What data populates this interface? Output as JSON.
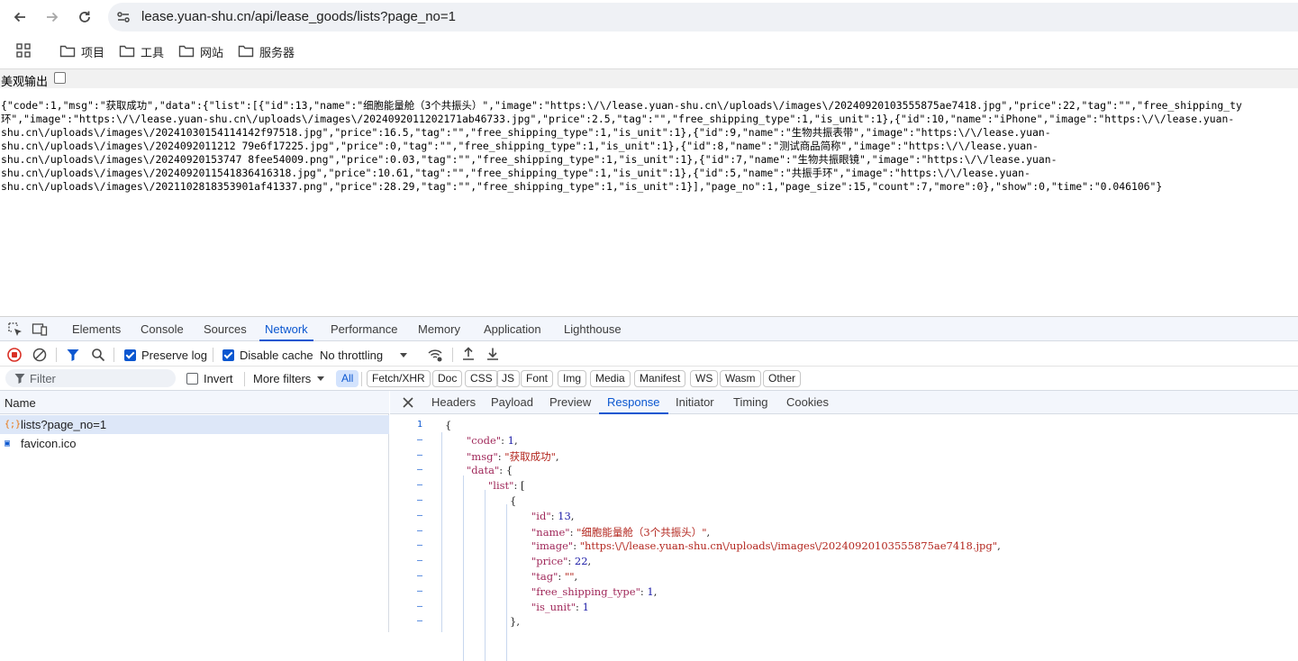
{
  "browser": {
    "url": "lease.yuan-shu.cn/api/lease_goods/lists?page_no=1",
    "bookmarks": [
      "项目",
      "工具",
      "网站",
      "服务器"
    ]
  },
  "page": {
    "pretty_print_label": "美观输出",
    "raw_lines": [
      "{\"code\":1,\"msg\":\"获取成功\",\"data\":{\"list\":[{\"id\":13,\"name\":\"细胞能量舱（3个共振头）\",\"image\":\"https:\\/\\/lease.yuan-shu.cn\\/uploads\\/images\\/20240920103555875ae7418.jpg\",\"price\":22,\"tag\":\"\",\"free_shipping_ty",
      "环\",\"image\":\"https:\\/\\/lease.yuan-shu.cn\\/uploads\\/images\\/2024092011202171ab46733.jpg\",\"price\":2.5,\"tag\":\"\",\"free_shipping_type\":1,\"is_unit\":1},{\"id\":10,\"name\":\"iPhone\",\"image\":\"https:\\/\\/lease.yuan-",
      "shu.cn\\/uploads\\/images\\/20241030154114142f97518.jpg\",\"price\":16.5,\"tag\":\"\",\"free_shipping_type\":1,\"is_unit\":1},{\"id\":9,\"name\":\"生物共振表带\",\"image\":\"https:\\/\\/lease.yuan-",
      "shu.cn\\/uploads\\/images\\/2024092011212 79e6f17225.jpg\",\"price\":0,\"tag\":\"\",\"free_shipping_type\":1,\"is_unit\":1},{\"id\":8,\"name\":\"测试商品简称\",\"image\":\"https:\\/\\/lease.yuan-",
      "shu.cn\\/uploads\\/images\\/20240920153747 8fee54009.png\",\"price\":0.03,\"tag\":\"\",\"free_shipping_type\":1,\"is_unit\":1},{\"id\":7,\"name\":\"生物共振眼镜\",\"image\":\"https:\\/\\/lease.yuan-",
      "shu.cn\\/uploads\\/images\\/2024092011541836416318.jpg\",\"price\":10.61,\"tag\":\"\",\"free_shipping_type\":1,\"is_unit\":1},{\"id\":5,\"name\":\"共振手环\",\"image\":\"https:\\/\\/lease.yuan-",
      "shu.cn\\/uploads\\/images\\/2021102818353901af41337.png\",\"price\":28.29,\"tag\":\"\",\"free_shipping_type\":1,\"is_unit\":1}],\"page_no\":1,\"page_size\":15,\"count\":7,\"more\":0},\"show\":0,\"time\":\"0.046106\"}"
    ]
  },
  "devtools": {
    "tabs": [
      "Elements",
      "Console",
      "Sources",
      "Network",
      "Performance",
      "Memory",
      "Application",
      "Lighthouse"
    ],
    "active_tab": "Network",
    "network_toolbar": {
      "preserve_log": "Preserve log",
      "disable_cache": "Disable cache",
      "throttling": "No throttling"
    },
    "filter": {
      "placeholder": "Filter",
      "invert": "Invert",
      "more_filters": "More filters",
      "types": [
        "All",
        "Fetch/XHR",
        "Doc",
        "CSS",
        "JS",
        "Font",
        "Img",
        "Media",
        "Manifest",
        "WS",
        "Wasm",
        "Other"
      ]
    },
    "requests": {
      "header": "Name",
      "items": [
        "lists?page_no=1",
        "favicon.ico"
      ]
    },
    "detail_tabs": [
      "Headers",
      "Payload",
      "Preview",
      "Response",
      "Initiator",
      "Timing",
      "Cookies"
    ],
    "active_detail_tab": "Response",
    "response_lines": [
      {
        "ln": "1",
        "indent": 0,
        "text": "{"
      },
      {
        "ln": "–",
        "indent": 1,
        "key": "\"code\"",
        "val": "1",
        "vtype": "n",
        "tail": ","
      },
      {
        "ln": "–",
        "indent": 1,
        "key": "\"msg\"",
        "val": "\"获取成功\"",
        "vtype": "s",
        "tail": ","
      },
      {
        "ln": "–",
        "indent": 1,
        "key": "\"data\"",
        "val": "{",
        "vtype": "p",
        "tail": ""
      },
      {
        "ln": "–",
        "indent": 2,
        "key": "\"list\"",
        "val": "[",
        "vtype": "p",
        "tail": ""
      },
      {
        "ln": "–",
        "indent": 3,
        "text": "{"
      },
      {
        "ln": "–",
        "indent": 4,
        "key": "\"id\"",
        "val": "13",
        "vtype": "n",
        "tail": ","
      },
      {
        "ln": "–",
        "indent": 4,
        "key": "\"name\"",
        "val": "\"细胞能量舱（3个共振头）\"",
        "vtype": "s",
        "tail": ","
      },
      {
        "ln": "–",
        "indent": 4,
        "key": "\"image\"",
        "val": "\"https:\\/\\/lease.yuan-shu.cn\\/uploads\\/images\\/20240920103555875ae7418.jpg\"",
        "vtype": "s",
        "tail": ","
      },
      {
        "ln": "–",
        "indent": 4,
        "key": "\"price\"",
        "val": "22",
        "vtype": "n",
        "tail": ","
      },
      {
        "ln": "–",
        "indent": 4,
        "key": "\"tag\"",
        "val": "\"\"",
        "vtype": "s",
        "tail": ","
      },
      {
        "ln": "–",
        "indent": 4,
        "key": "\"free_shipping_type\"",
        "val": "1",
        "vtype": "n",
        "tail": ","
      },
      {
        "ln": "–",
        "indent": 4,
        "key": "\"is_unit\"",
        "val": "1",
        "vtype": "n",
        "tail": ""
      },
      {
        "ln": "–",
        "indent": 3,
        "text": "},"
      }
    ]
  }
}
